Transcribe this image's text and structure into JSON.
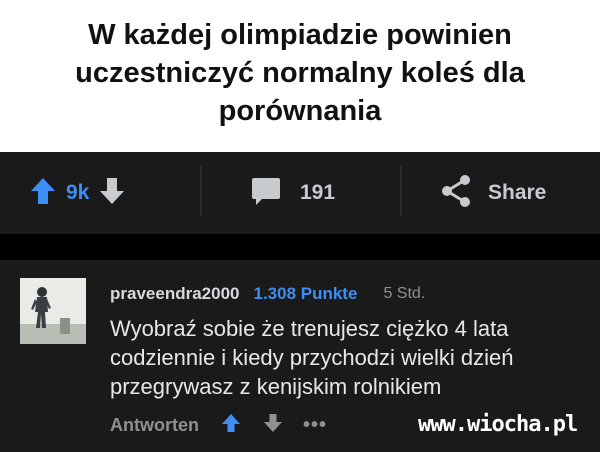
{
  "caption": {
    "text": "W każdej olimpiadzie powinien uczestniczyć normalny koleś dla porównania"
  },
  "toolbar": {
    "vote_count": "9k",
    "comment_count": "191",
    "share_label": "Share"
  },
  "comment": {
    "username": "praveendra2000",
    "points": "1.308 Punkte",
    "age": "5 Std.",
    "body": "Wyobraź sobie że trenujesz ciężko 4 lata codziennie i kiedy przychodzi wielki dzień przegrywasz z kenijskim rolnikiem",
    "reply_label": "Antworten",
    "more_label": "•••"
  },
  "watermark": {
    "text": "www.wiocha.pl"
  },
  "colors": {
    "accent_blue": "#3d8ef5",
    "toolbar_bg": "#1a1a1b",
    "muted_text": "#8e9192"
  }
}
